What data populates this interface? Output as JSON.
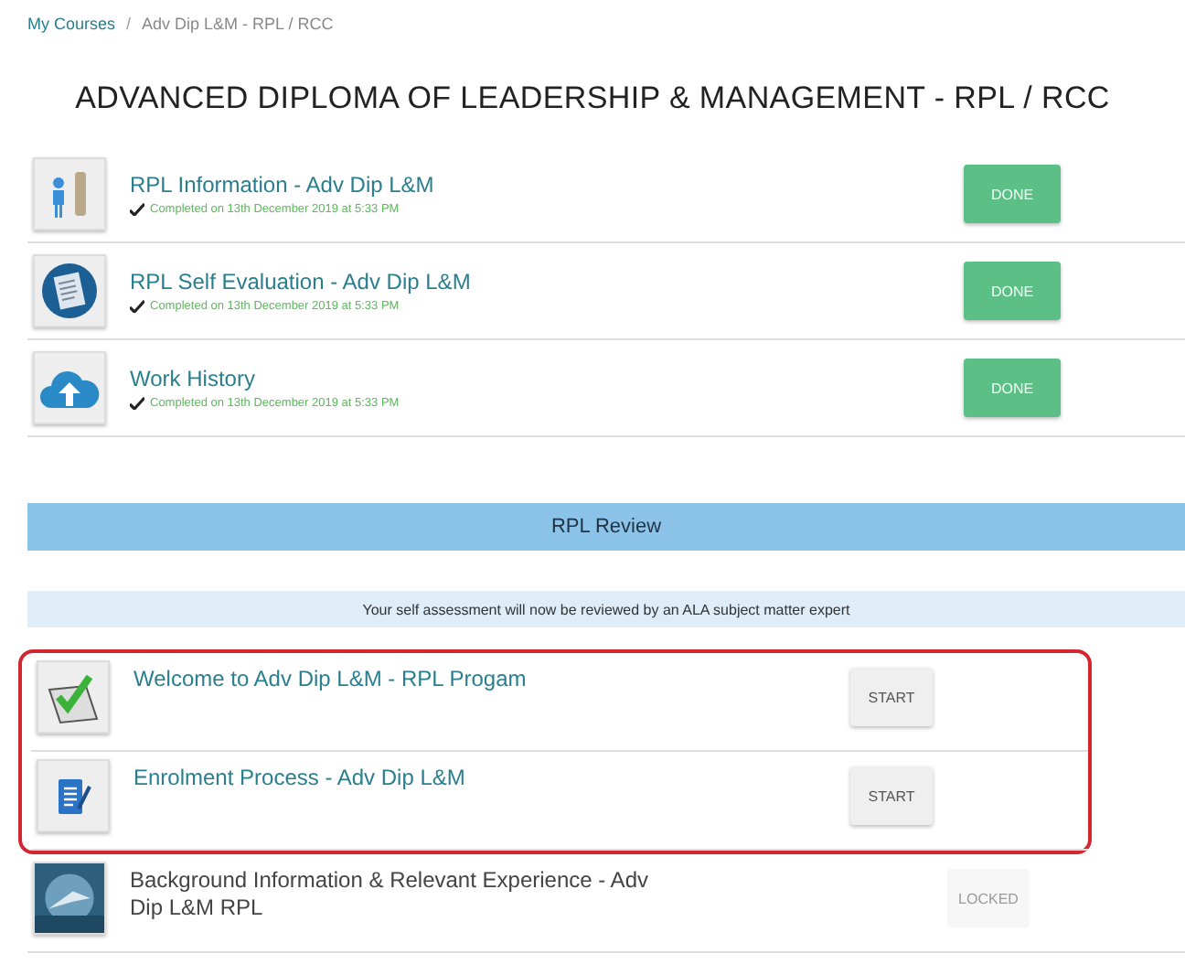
{
  "breadcrumb": [
    {
      "kind": "link",
      "label": "My Courses"
    },
    {
      "kind": "separator",
      "label": "/"
    },
    {
      "kind": "current",
      "label": "Adv Dip L&M - RPL / RCC"
    }
  ],
  "title": "ADVANCED DIPLOMA OF LEADERSHIP & MANAGEMENT - RPL / RCC",
  "modules": [
    {
      "title": "RPL Information - Adv Dip L&M",
      "completed": "Completed on 13th December 2019 at 5:33 PM",
      "kind": "done",
      "button": "DONE"
    },
    {
      "title": "RPL Self Evaluation - Adv Dip L&M",
      "completed": "Completed on 13th December 2019 at 5:33 PM",
      "kind": "done",
      "button": "DONE"
    },
    {
      "title": "Work History",
      "completed": "Completed on 13th December 2019 at 5:33 PM",
      "kind": "done",
      "button": "DONE"
    }
  ],
  "review": {
    "header": "RPL Review",
    "notice": "Your self assessment will now be reviewed by an ALA subject matter expert",
    "modules": [
      {
        "title": "Welcome to Adv Dip L&M - RPL Progam",
        "kind": "start",
        "button": "START",
        "highlighted": true
      },
      {
        "title": "Enrolment Process - Adv Dip L&M",
        "kind": "start",
        "button": "START",
        "highlighted": true
      },
      {
        "title": "Background Information & Relevant Experience - Adv Dip L&M RPL",
        "kind": "locked",
        "button": "LOCKED",
        "highlighted": false
      }
    ]
  }
}
